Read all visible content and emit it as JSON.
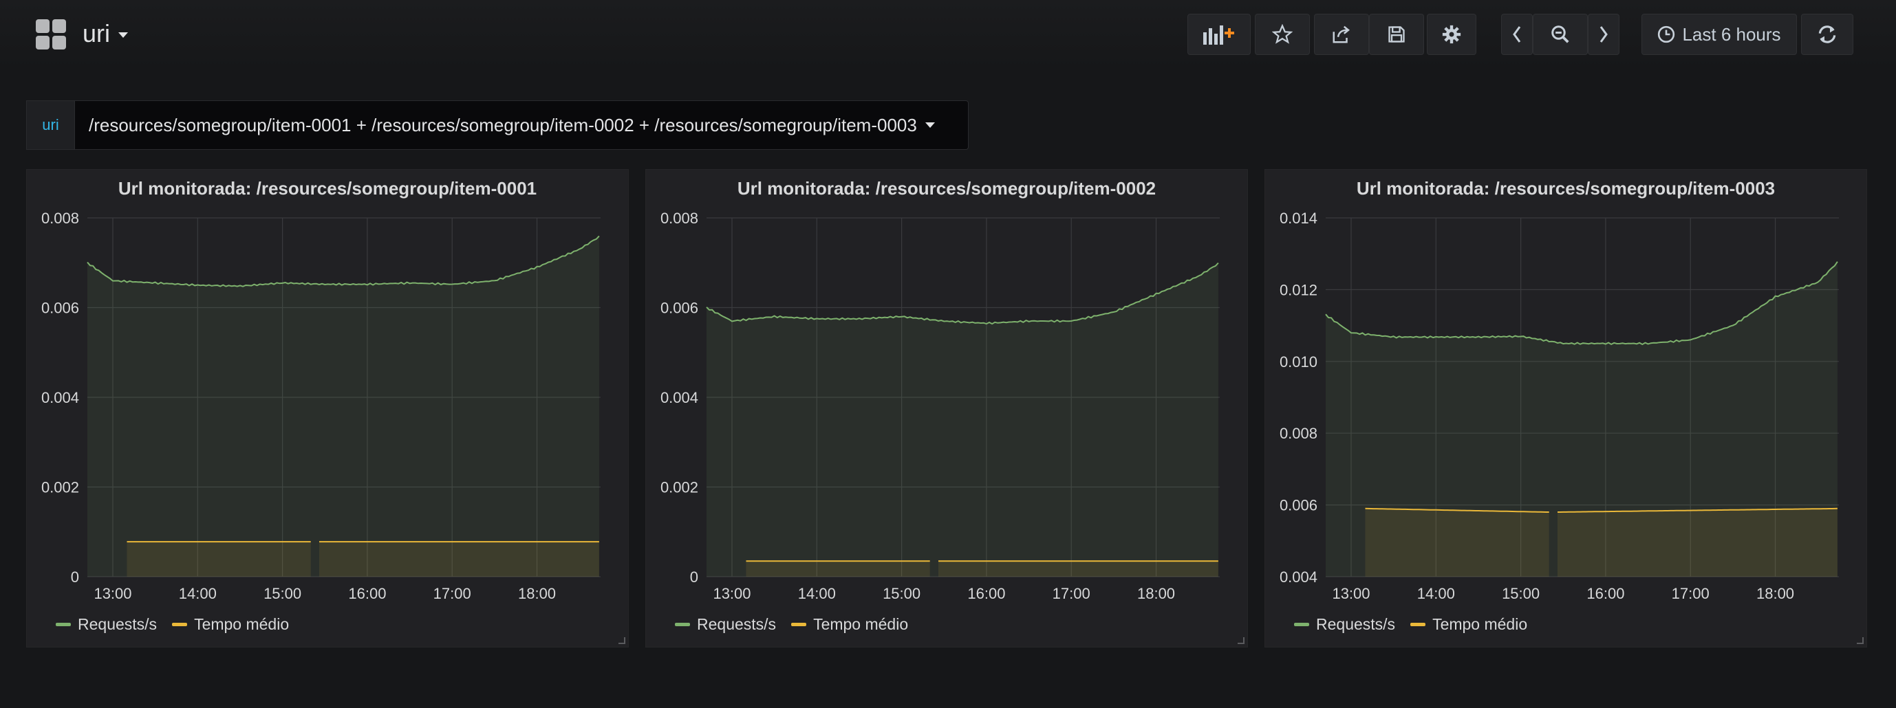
{
  "header": {
    "dashboard_title": "uri",
    "time_range": "Last 6 hours",
    "icons": [
      "grid-logo",
      "add-panel",
      "star",
      "share",
      "save",
      "settings",
      "chevron-left",
      "zoom-out",
      "chevron-right",
      "clock",
      "refresh"
    ]
  },
  "variable": {
    "label": "uri",
    "value": "/resources/somegroup/item-0001 + /resources/somegroup/item-0002 + /resources/somegroup/item-0003"
  },
  "colors": {
    "requests": "#7eb26d",
    "tempo": "#eab839",
    "accent_variable": "#33b5e5"
  },
  "panels": [
    {
      "title": "Url monitorada: /resources/somegroup/item-0001"
    },
    {
      "title": "Url monitorada: /resources/somegroup/item-0002"
    },
    {
      "title": "Url monitorada: /resources/somegroup/item-0003"
    }
  ],
  "chart_data": [
    {
      "type": "area",
      "title": "Url monitorada: /resources/somegroup/item-0001",
      "x_ticks": [
        "13:00",
        "14:00",
        "15:00",
        "16:00",
        "17:00",
        "18:00"
      ],
      "y_ticks": [
        "0",
        "0.002",
        "0.004",
        "0.006",
        "0.008"
      ],
      "ylim": [
        0,
        0.008
      ],
      "grid": true,
      "legend": "bottom-left",
      "series": [
        {
          "name": "Requests/s",
          "x": [
            "12:42",
            "13:00",
            "13:30",
            "14:00",
            "14:30",
            "15:00",
            "15:30",
            "16:00",
            "16:30",
            "17:00",
            "17:30",
            "18:00",
            "18:30",
            "18:45"
          ],
          "values": [
            0.007,
            0.0066,
            0.00655,
            0.0065,
            0.00648,
            0.00655,
            0.00652,
            0.00652,
            0.00655,
            0.00652,
            0.0066,
            0.0069,
            0.0073,
            0.0076
          ]
        },
        {
          "name": "Tempo médio",
          "x": [
            "13:10",
            "15:20",
            "15:25",
            "18:45"
          ],
          "values": [
            0.00078,
            0.00078,
            0.00078,
            0.00078
          ],
          "gap": [
            "15:20",
            "15:25"
          ]
        }
      ]
    },
    {
      "type": "area",
      "title": "Url monitorada: /resources/somegroup/item-0002",
      "x_ticks": [
        "13:00",
        "14:00",
        "15:00",
        "16:00",
        "17:00",
        "18:00"
      ],
      "y_ticks": [
        "0",
        "0.002",
        "0.004",
        "0.006",
        "0.008"
      ],
      "ylim": [
        0,
        0.008
      ],
      "grid": true,
      "legend": "bottom-left",
      "series": [
        {
          "name": "Requests/s",
          "x": [
            "12:42",
            "13:00",
            "13:30",
            "14:00",
            "14:30",
            "15:00",
            "15:30",
            "16:00",
            "16:30",
            "17:00",
            "17:30",
            "18:00",
            "18:30",
            "18:45"
          ],
          "values": [
            0.006,
            0.0057,
            0.0058,
            0.00575,
            0.00575,
            0.0058,
            0.0057,
            0.00565,
            0.0057,
            0.0057,
            0.0059,
            0.0063,
            0.0067,
            0.007
          ],
          "dip_window": [
            "15:10",
            "17:00"
          ]
        },
        {
          "name": "Tempo médio",
          "x": [
            "13:10",
            "15:20",
            "15:25",
            "18:45"
          ],
          "values": [
            0.00035,
            0.00035,
            0.00035,
            0.00035
          ],
          "gap": [
            "15:20",
            "15:25"
          ]
        }
      ]
    },
    {
      "type": "area",
      "title": "Url monitorada: /resources/somegroup/item-0003",
      "x_ticks": [
        "13:00",
        "14:00",
        "15:00",
        "16:00",
        "17:00",
        "18:00"
      ],
      "y_ticks": [
        "0.004",
        "0.006",
        "0.008",
        "0.010",
        "0.012",
        "0.014"
      ],
      "ylim": [
        0.004,
        0.014
      ],
      "grid": true,
      "legend": "bottom-left",
      "series": [
        {
          "name": "Requests/s",
          "x": [
            "12:42",
            "13:00",
            "13:30",
            "14:00",
            "14:30",
            "15:00",
            "15:30",
            "16:00",
            "16:30",
            "17:00",
            "17:30",
            "18:00",
            "18:30",
            "18:45"
          ],
          "values": [
            0.0113,
            0.0108,
            0.01068,
            0.01068,
            0.01068,
            0.0107,
            0.0105,
            0.0105,
            0.0105,
            0.0106,
            0.011,
            0.0118,
            0.0122,
            0.0128
          ]
        },
        {
          "name": "Tempo médio",
          "x": [
            "13:10",
            "15:20",
            "15:25",
            "18:45"
          ],
          "values": [
            0.0059,
            0.0058,
            0.0058,
            0.0059
          ],
          "gap": [
            "15:20",
            "15:25"
          ]
        }
      ]
    }
  ]
}
